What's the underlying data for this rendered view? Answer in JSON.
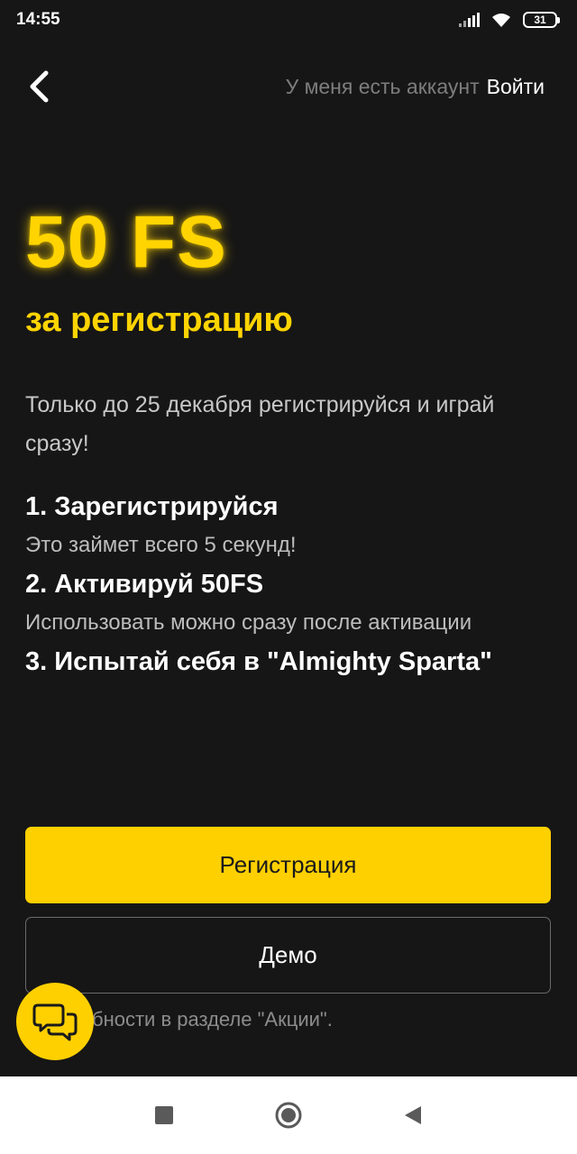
{
  "status_bar": {
    "time": "14:55",
    "battery": "31"
  },
  "header": {
    "account_prompt": "У меня есть аккаунт",
    "login_label": "Войти"
  },
  "hero": {
    "title": "50 FS",
    "subtitle": "за регистрацию"
  },
  "intro": "Только до 25 декабря регистрируйся и играй сразу!",
  "steps": [
    {
      "title": "1. Зарегистрируйся",
      "desc": "Это займет всего 5 секунд!"
    },
    {
      "title": "2. Активируй 50FS",
      "desc": "Использовать можно сразу после активации"
    },
    {
      "title": "3. Испытай себя в \"Almighty Sparta\"",
      "desc": ""
    }
  ],
  "buttons": {
    "register": "Регистрация",
    "demo": "Демо"
  },
  "footer_note": "бности в разделе \"Акции\".",
  "colors": {
    "accent": "#ffd000",
    "background": "#161616"
  }
}
